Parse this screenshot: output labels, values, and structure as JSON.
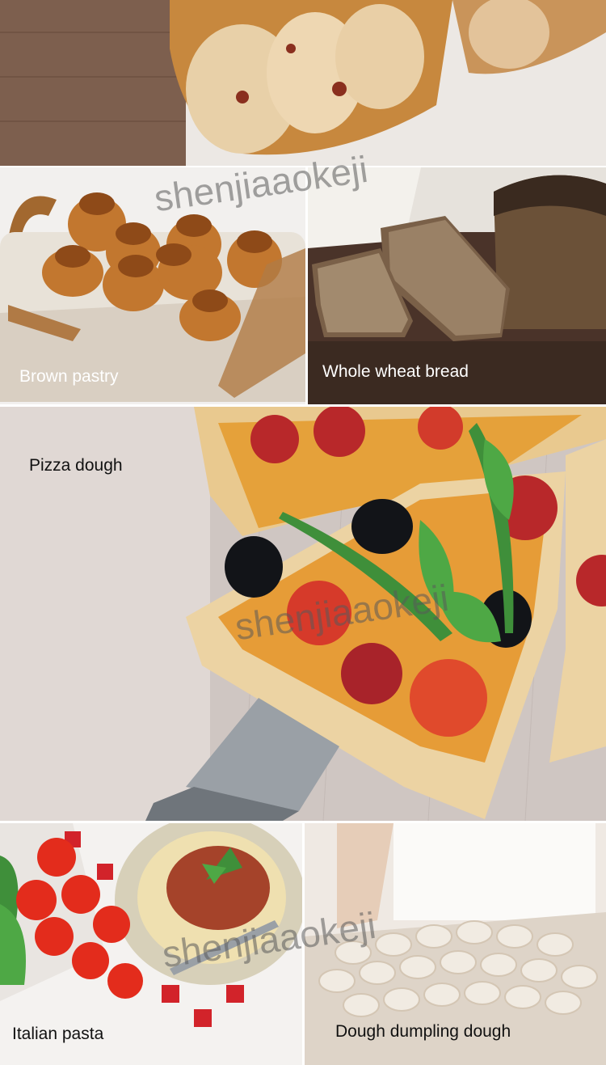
{
  "panels": {
    "top_bread": {
      "alt": "sliced bread on parchment"
    },
    "brown_pastry": {
      "caption": "Brown pastry"
    },
    "whole_wheat": {
      "caption": "Whole wheat bread"
    },
    "pizza": {
      "caption": "Pizza dough"
    },
    "pasta": {
      "caption": "Italian pasta"
    },
    "dumpling": {
      "caption": "Dough dumpling dough"
    }
  },
  "watermark": "shenjiaaokeji",
  "colors": {
    "caption_light": "#ffffff",
    "caption_dark": "#111111",
    "wood": "#8a6b58",
    "crust": "#c98a3a"
  }
}
